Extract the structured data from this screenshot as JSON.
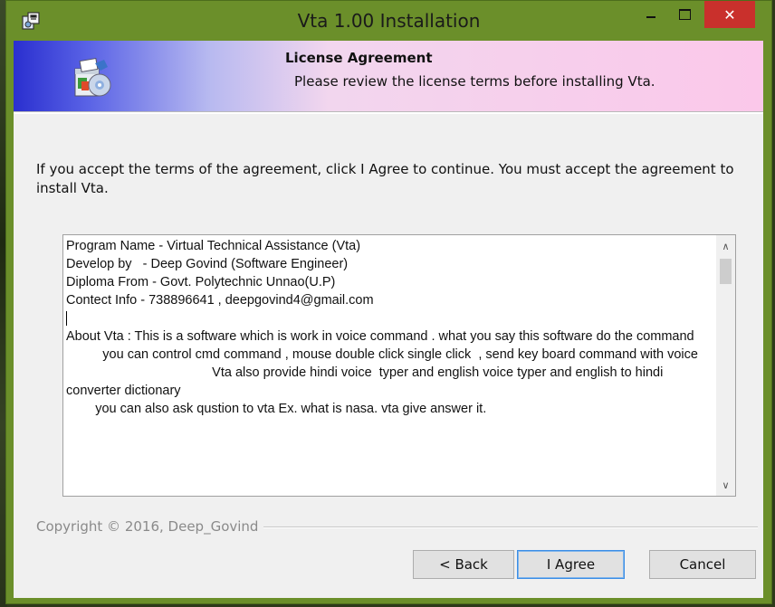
{
  "window": {
    "title": "Vta 1.00 Installation",
    "icons": {
      "app": "installer-icon",
      "minimize": "minimize-icon",
      "maximize": "maximize-icon",
      "close": "close-icon"
    },
    "close_glyph": "✕"
  },
  "header": {
    "title": "License Agreement",
    "subtitle": "Please review the license terms before installing Vta.",
    "icon": "setup-package-icon"
  },
  "intro": "If you accept the terms of the agreement, click I Agree to continue. You must accept the agreement to install Vta.",
  "license": {
    "lines": [
      "Program Name - Virtual Technical Assistance (Vta)",
      "Develop by   - Deep Govind (Software Engineer)",
      "Diploma From - Govt. Polytechnic Unnao(U.P)",
      "Contect Info - 738896641 , deepgovind4@gmail.com",
      "",
      "About Vta : This is a software which is work in voice command . what you say this software do the command",
      "          you can control cmd command , mouse double click single click  , send key board command with voice",
      "                                        Vta also provide hindi voice  typer and english voice typer and english to hindi converter dictionary",
      "        you can also ask qustion to vta Ex. what is nasa. vta give answer it."
    ]
  },
  "scrollbar": {
    "up_glyph": "∧",
    "down_glyph": "∨"
  },
  "footer": {
    "copyright": "Copyright © 2016, Deep_Govind",
    "back_label": "< Back",
    "agree_label": "I Agree",
    "cancel_label": "Cancel"
  },
  "colors": {
    "title_bar": "#6b8f2a",
    "close_button": "#c9302c",
    "header_gradient_start": "#2a2fcf",
    "header_gradient_end": "#fbc8ea",
    "dialog_bg": "#f0f0f0"
  }
}
